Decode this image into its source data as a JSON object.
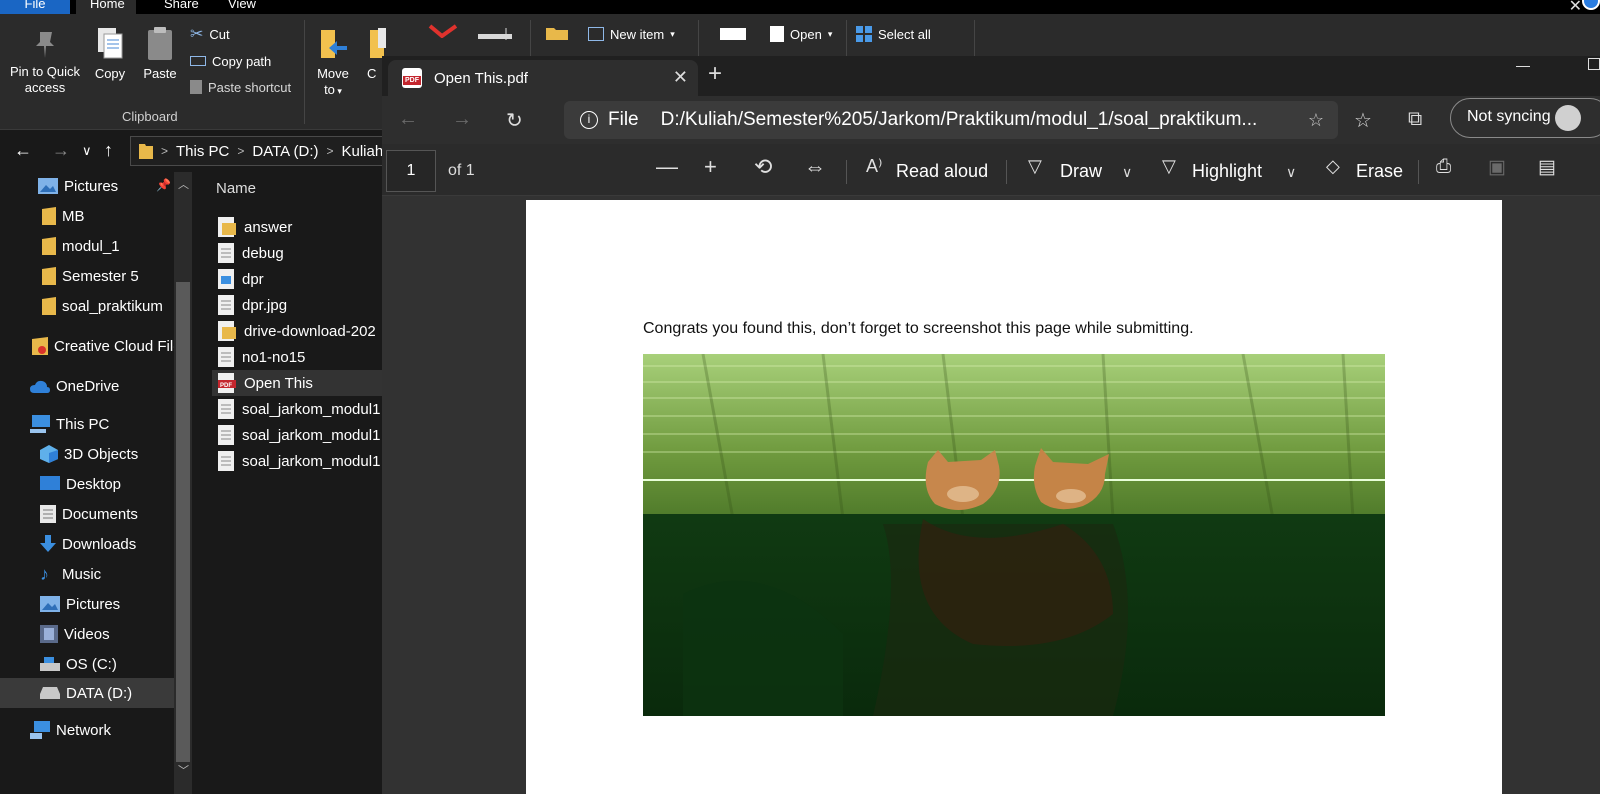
{
  "explorer": {
    "ribbon_tabs": [
      "File",
      "Home",
      "Share",
      "View"
    ],
    "ribbon": {
      "pin_label": "Pin to Quick access",
      "copy_label": "Copy",
      "paste_label": "Paste",
      "cut_label": "Cut",
      "copy_path_label": "Copy path",
      "paste_shortcut_label": "Paste shortcut",
      "clipboard_group": "Clipboard",
      "move_to_label": "Move to",
      "move_to_label_line1": "Move",
      "move_to_label_line2": "to",
      "copy_to_label": "C",
      "new_item_label": "New item",
      "open_label": "Open",
      "select_all_label": "Select all"
    },
    "breadcrumb": [
      "This PC",
      "DATA (D:)",
      "Kuliah"
    ],
    "nav_pane": [
      {
        "label": "Pictures",
        "icon": "pictures-icon",
        "pinned": true
      },
      {
        "label": "MB",
        "icon": "folder-icon"
      },
      {
        "label": "modul_1",
        "icon": "folder-icon"
      },
      {
        "label": "Semester 5",
        "icon": "folder-icon"
      },
      {
        "label": "soal_praktikum",
        "icon": "folder-icon"
      },
      {
        "label": "Creative Cloud Files",
        "icon": "creative-cloud-icon"
      },
      {
        "label": "OneDrive",
        "icon": "onedrive-icon"
      },
      {
        "label": "This PC",
        "icon": "this-pc-icon"
      },
      {
        "label": "3D Objects",
        "icon": "3d-objects-icon"
      },
      {
        "label": "Desktop",
        "icon": "desktop-icon"
      },
      {
        "label": "Documents",
        "icon": "documents-icon"
      },
      {
        "label": "Downloads",
        "icon": "downloads-icon"
      },
      {
        "label": "Music",
        "icon": "music-icon"
      },
      {
        "label": "Pictures",
        "icon": "pictures-icon"
      },
      {
        "label": "Videos",
        "icon": "videos-icon"
      },
      {
        "label": "OS (C:)",
        "icon": "drive-icon"
      },
      {
        "label": "DATA (D:)",
        "icon": "drive-icon",
        "selected": true
      },
      {
        "label": "Network",
        "icon": "network-icon"
      }
    ],
    "file_pane": {
      "column_name": "Name",
      "files": [
        {
          "name": "answer",
          "icon": "archive-file-icon"
        },
        {
          "name": "debug",
          "icon": "text-file-icon"
        },
        {
          "name": "dpr",
          "icon": "image-file-icon"
        },
        {
          "name": "dpr.jpg",
          "icon": "text-file-icon"
        },
        {
          "name": "drive-download-202",
          "icon": "archive-file-icon"
        },
        {
          "name": "no1-no15",
          "icon": "text-file-icon"
        },
        {
          "name": "Open This",
          "icon": "pdf-file-icon",
          "hover": true
        },
        {
          "name": "soal_jarkom_modul1",
          "icon": "text-file-icon"
        },
        {
          "name": "soal_jarkom_modul1",
          "icon": "text-file-icon"
        },
        {
          "name": "soal_jarkom_modul1",
          "icon": "text-file-icon"
        }
      ]
    }
  },
  "edge": {
    "tab_title": "Open This.pdf",
    "address_scheme": "File",
    "address_url": "D:/Kuliah/Semester%205/Jarkom/Praktikum/modul_1/soal_praktikum...",
    "sync_label": "Not syncing",
    "pdf_toolbar": {
      "page_number": "1",
      "page_of": "of 1",
      "read_aloud": "Read aloud",
      "draw": "Draw",
      "highlight": "Highlight",
      "erase": "Erase"
    },
    "document": {
      "text": "Congrats you found this, don’t forget to screenshot this page while submitting."
    }
  },
  "colors": {
    "accent": "#1a66c4",
    "pdf_red": "#c4262e",
    "folder_yellow": "#e8b84a"
  }
}
